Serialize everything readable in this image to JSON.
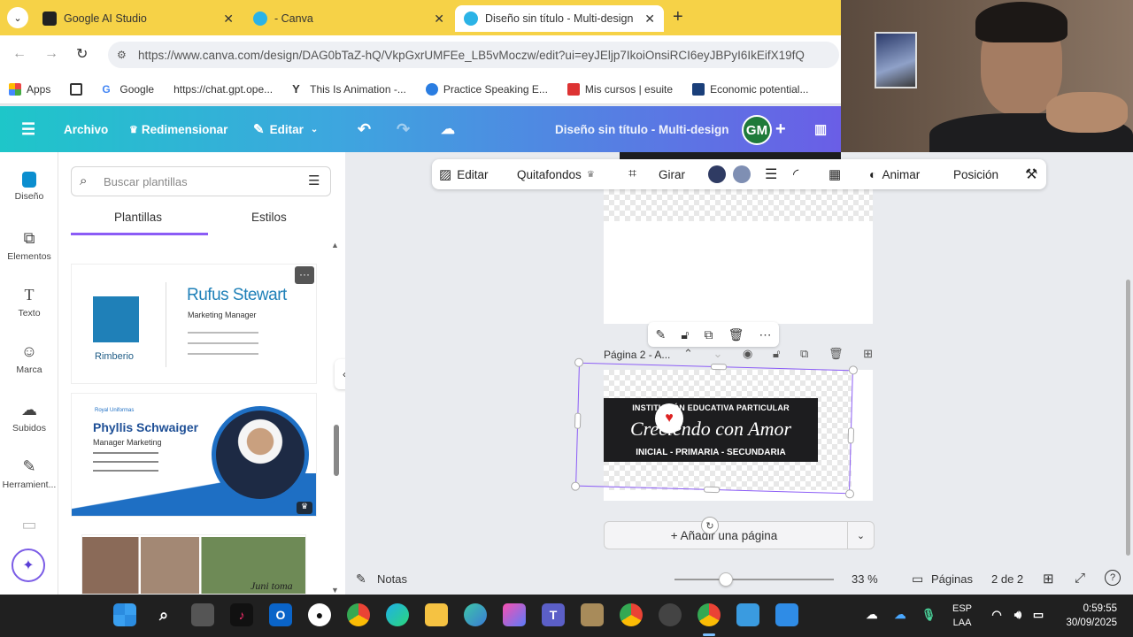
{
  "browser": {
    "tabs": [
      {
        "label": "Google AI Studio",
        "close": "✕"
      },
      {
        "label": "- Canva",
        "close": "✕"
      },
      {
        "label": "Diseño sin título - Multi-design",
        "close": "✕"
      }
    ],
    "new_tab": "+",
    "url": "https://www.canva.com/design/DAG0bTaZ-hQ/VkpGxrUMFEe_LB5vMoczw/edit?ui=eyJEljp7IkoiOnsiRCI6eyJBPyI6IkEifX19fQ",
    "bookmarks": [
      "Apps",
      "Google",
      "https://chat.gpt.ope...",
      "This Is Animation -...",
      "Practice Speaking E...",
      "Mis cursos | esuite",
      "Economic potential..."
    ]
  },
  "canva": {
    "menu": {
      "archivo": "Archivo",
      "redimensionar": "Redimensionar",
      "editar": "Editar"
    },
    "doc_title": "Diseño sin título - Multi-design",
    "avatar": "GM",
    "avatar_color": "#1f7a3a",
    "sidebar": [
      {
        "label": "Diseño",
        "icon": "design-icon"
      },
      {
        "label": "Elementos",
        "icon": "elements-icon"
      },
      {
        "label": "Texto",
        "icon": "text-icon"
      },
      {
        "label": "Marca",
        "icon": "brand-icon"
      },
      {
        "label": "Subidos",
        "icon": "upload-icon"
      },
      {
        "label": "Herramient...",
        "icon": "tools-icon"
      }
    ],
    "search_placeholder": "Buscar plantillas",
    "panel_tabs": [
      "Plantillas",
      "Estilos"
    ],
    "templates": {
      "card1": {
        "logo": "Rimberio",
        "name": "Rufus Stewart",
        "role": "Marketing Manager"
      },
      "card2": {
        "brand": "Royal Uniformas",
        "name": "Phyllis Schwaiger",
        "role": "Manager Marketing"
      },
      "card3": {
        "caption": "Juni toma"
      }
    },
    "context_toolbar": {
      "editar": "Editar",
      "quitafondos": "Quitafondos",
      "girar": "Girar",
      "animar": "Animar",
      "posicion": "Posición",
      "color1": "#2f3b63",
      "color2": "#7f8fb3"
    },
    "page2_label": "Página 2 - A...",
    "banner": {
      "line1": "INSTITUCIÓN EDUCATIVA PARTICULAR",
      "line2": "Creciendo con Amor",
      "line3": "INICIAL - PRIMARIA - SECUNDARIA"
    },
    "add_page": "+ Añadir una página",
    "bottom": {
      "notas": "Notas",
      "zoom": 33,
      "zoom_label": "33 %",
      "paginas": "Páginas",
      "page_count": "2 de 2"
    }
  },
  "taskbar": {
    "lang1": "ESP",
    "lang2": "LAA",
    "time": "0:59:55",
    "date": "30/09/2025"
  }
}
